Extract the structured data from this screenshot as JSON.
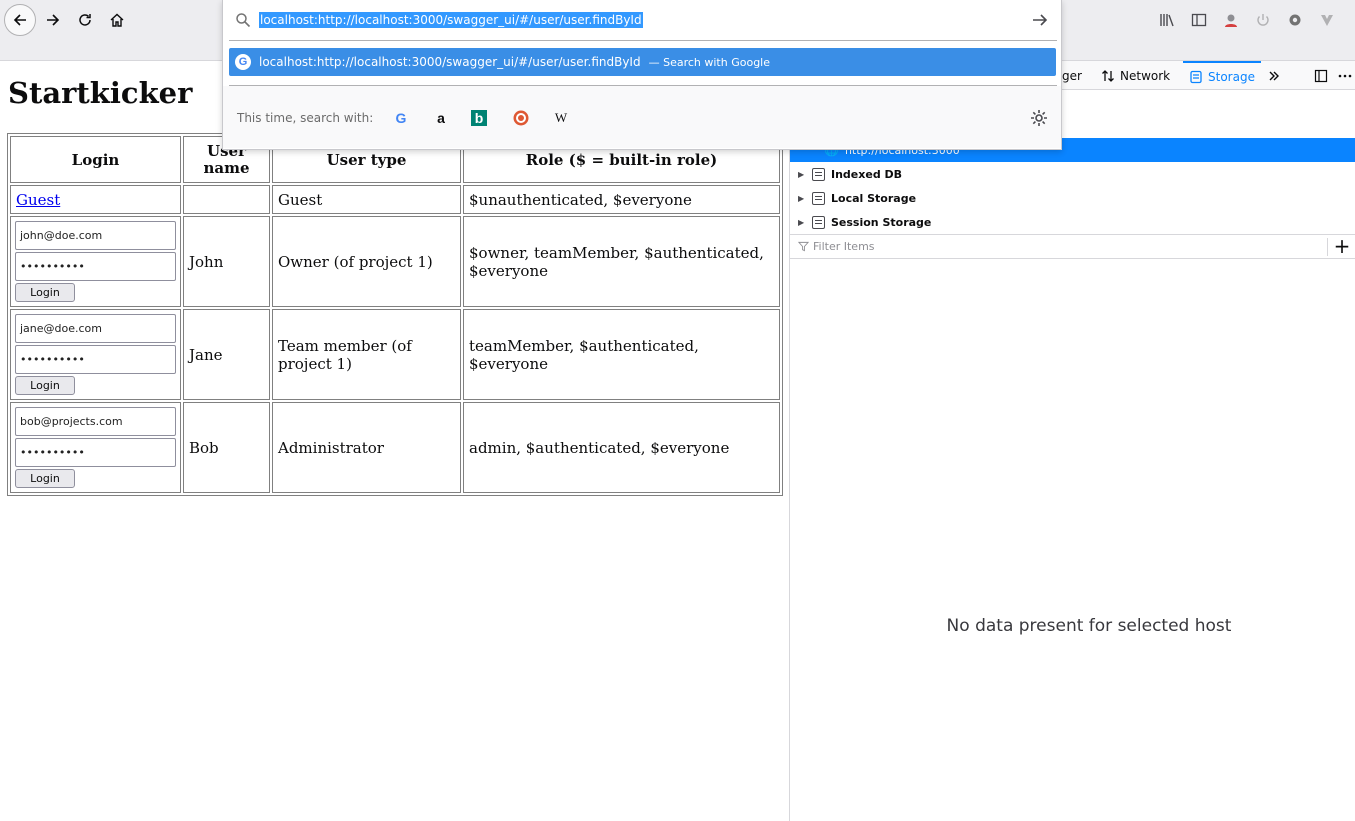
{
  "browser": {
    "url": "localhost:http://localhost:3000/swagger_ui/#/user/user.findById",
    "suggestion_text": "localhost:http://localhost:3000/swagger_ui/#/user/user.findById",
    "suggestion_action": "— Search with Google",
    "oneoff_label": "This time, search with:",
    "engines": [
      "google-icon",
      "amazon-icon",
      "bing-icon",
      "duckduckgo-icon",
      "wikipedia-icon"
    ],
    "engine_glyphs": {
      "google": "G",
      "amazon": "a",
      "bing": "b",
      "wikipedia": "W"
    }
  },
  "page": {
    "title": "Startkicker",
    "table": {
      "headers": {
        "login": "Login",
        "username": "User name",
        "usertype": "User type",
        "role": "Role ($ = built-in role)"
      },
      "guest": {
        "link": "Guest",
        "usertype": "Guest",
        "role": "$unauthenticated, $everyone"
      },
      "rows": [
        {
          "email": "john@doe.com",
          "password": "••••••••••",
          "button": "Login",
          "name": "John",
          "usertype": "Owner (of project 1)",
          "role": "$owner, teamMember, $authenticated, $everyone"
        },
        {
          "email": "jane@doe.com",
          "password": "••••••••••",
          "button": "Login",
          "name": "Jane",
          "usertype": "Team member (of project 1)",
          "role": "teamMember, $authenticated, $everyone"
        },
        {
          "email": "bob@projects.com",
          "password": "••••••••••",
          "button": "Login",
          "name": "Bob",
          "usertype": "Administrator",
          "role": "admin, $authenticated, $everyone"
        }
      ]
    }
  },
  "devtools": {
    "tabs": {
      "debugger_partial": "ger",
      "network": "Network",
      "storage": "Storage"
    },
    "selected_host": "http://localhost:3000",
    "tree": [
      "Indexed DB",
      "Local Storage",
      "Session Storage"
    ],
    "filter_placeholder": "Filter Items",
    "empty_message": "No data present for selected host",
    "accent": "#0a84ff"
  }
}
